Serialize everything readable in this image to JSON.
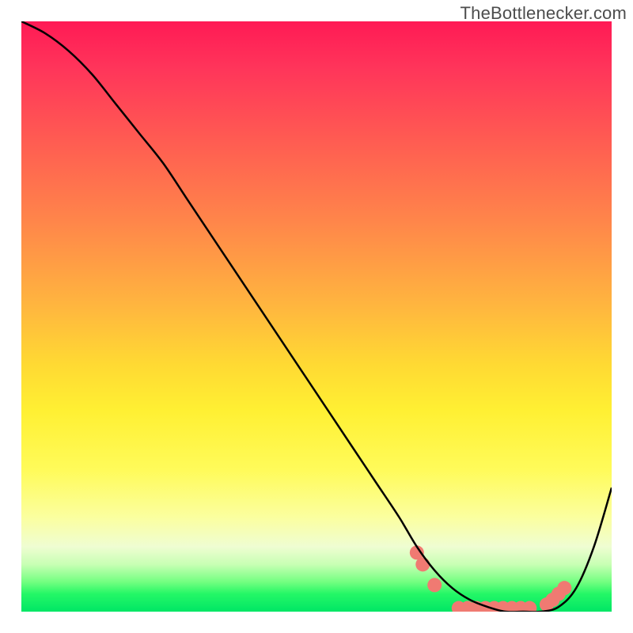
{
  "watermark": "TheBottlenecker.com",
  "chart_data": {
    "type": "line",
    "title": "",
    "xlabel": "",
    "ylabel": "",
    "xlim": [
      0,
      100
    ],
    "ylim": [
      0,
      100
    ],
    "grid": false,
    "series": [
      {
        "name": "bottleneck-curve",
        "stroke": "#000000",
        "stroke_width": 2.5,
        "x": [
          0,
          4,
          8,
          12,
          16,
          20,
          24,
          28,
          32,
          36,
          40,
          44,
          48,
          52,
          56,
          60,
          64,
          67,
          70,
          73,
          76,
          79,
          82,
          85,
          88,
          91,
          94,
          97,
          100
        ],
        "y": [
          100,
          98,
          95,
          91,
          86,
          81,
          76,
          70,
          64,
          58,
          52,
          46,
          40,
          34,
          28,
          22,
          16,
          11,
          7,
          4,
          2,
          0.8,
          0,
          0,
          0,
          0.8,
          4,
          11,
          21
        ]
      }
    ],
    "markers": {
      "name": "bottleneck-dots",
      "fill": "#f07a72",
      "r": 9,
      "note": "approximate positions of the salmon dots near the curve bottom; some adjacent dots overlap forming short pill shapes",
      "x": [
        67,
        68,
        70,
        74.1,
        75.6,
        77.1,
        78.6,
        80.1,
        81.6,
        83.1,
        84.6,
        86.1,
        89,
        90,
        91,
        92
      ],
      "y": [
        10,
        8,
        4.5,
        0.6,
        0.6,
        0.6,
        0.6,
        0.6,
        0.6,
        0.6,
        0.6,
        0.6,
        1.2,
        2,
        3,
        4
      ]
    },
    "background_gradient": {
      "direction": "vertical",
      "stops": [
        {
          "pos": 0.0,
          "color": "#ff1a55"
        },
        {
          "pos": 0.2,
          "color": "#ff5b52"
        },
        {
          "pos": 0.48,
          "color": "#ffb53f"
        },
        {
          "pos": 0.66,
          "color": "#fff033"
        },
        {
          "pos": 0.84,
          "color": "#fbff9f"
        },
        {
          "pos": 0.92,
          "color": "#c8ffb4"
        },
        {
          "pos": 1.0,
          "color": "#00e665"
        }
      ]
    }
  }
}
